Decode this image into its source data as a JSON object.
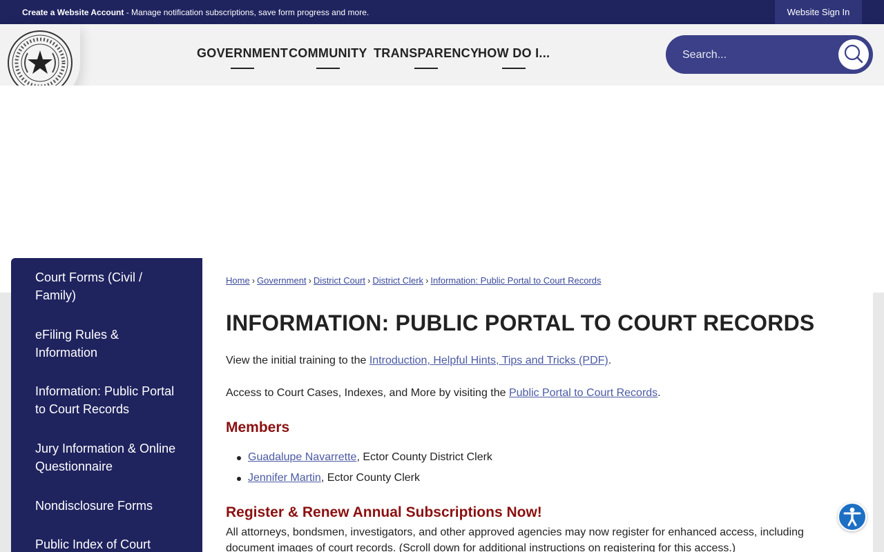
{
  "topbar": {
    "create_account": "Create a Website Account",
    "create_account_desc": " - Manage notification subscriptions, save form progress and more.",
    "sign_in": "Website Sign In"
  },
  "header": {
    "logo_alt": "County of Ector The State of Texas seal",
    "nav": [
      "GOVERNMENT",
      "COMMUNITY",
      "TRANSPARENCY",
      "HOW DO I..."
    ],
    "search_placeholder": "Search..."
  },
  "sidebar": {
    "items": [
      "Court Forms (Civil / Family)",
      "eFiling Rules & Information",
      "Information: Public Portal to Court Records",
      "Jury Information & Online Questionnaire",
      "Nondisclosure Forms",
      "Public Index of Court"
    ]
  },
  "breadcrumb": [
    "Home",
    "Government",
    "District Court",
    "District Clerk",
    "Information: Public Portal to Court Records"
  ],
  "page": {
    "title": "INFORMATION: PUBLIC PORTAL TO COURT RECORDS",
    "p1_text": "View the initial training to the ",
    "p1_link": "Introduction, Helpful Hints, Tips and Tricks (PDF)",
    "p1_end": ".",
    "p2_text": "Access to Court Cases, Indexes, and More by visiting the ",
    "p2_link": "Public Portal to Court Records",
    "p2_end": ".",
    "members_heading": "Members",
    "members": [
      {
        "name": "Guadalupe Navarrette",
        "role": ", Ector County District Clerk"
      },
      {
        "name": "Jennifer Martin",
        "role": ", Ector County Clerk"
      }
    ],
    "register_heading": "Register & Renew Annual Subscriptions Now!",
    "register_text": "All attorneys, bondsmen, investigators, and other approved agencies may now register for enhanced access, including document images of court records. (Scroll down for additional instructions on registering for this access.)"
  },
  "colors": {
    "navy": "#1f235e",
    "accent_red": "#8b1010",
    "link": "#4b5aa3"
  }
}
